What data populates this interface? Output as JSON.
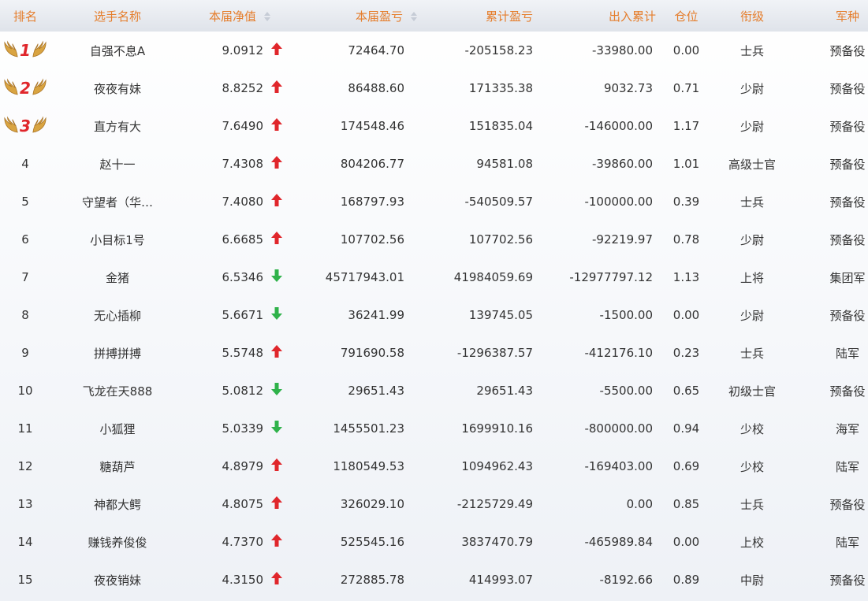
{
  "headers": {
    "rank": "排名",
    "name": "选手名称",
    "nav": "本届净值",
    "pnl": "本届盈亏",
    "cum": "累计盈亏",
    "flow": "出入累计",
    "position": "仓位",
    "military_rank": "衔级",
    "arm": "军种"
  },
  "colors": {
    "header_text": "#e57d2b",
    "up_arrow": "#e0262b",
    "down_arrow": "#2fb24a",
    "medal_number": "#e0262b"
  },
  "rows": [
    {
      "rank": "1",
      "name": "自强不息A",
      "nav": "9.0912",
      "dir": "up",
      "pnl": "72464.70",
      "cum": "-205158.23",
      "flow": "-33980.00",
      "position": "0.00",
      "military_rank": "士兵",
      "arm": "预备役"
    },
    {
      "rank": "2",
      "name": "夜夜有妹",
      "nav": "8.8252",
      "dir": "up",
      "pnl": "86488.60",
      "cum": "171335.38",
      "flow": "9032.73",
      "position": "0.71",
      "military_rank": "少尉",
      "arm": "预备役"
    },
    {
      "rank": "3",
      "name": "直方有大",
      "nav": "7.6490",
      "dir": "up",
      "pnl": "174548.46",
      "cum": "151835.04",
      "flow": "-146000.00",
      "position": "1.17",
      "military_rank": "少尉",
      "arm": "预备役"
    },
    {
      "rank": "4",
      "name": "赵十一",
      "nav": "7.4308",
      "dir": "up",
      "pnl": "804206.77",
      "cum": "94581.08",
      "flow": "-39860.00",
      "position": "1.01",
      "military_rank": "高级士官",
      "arm": "预备役"
    },
    {
      "rank": "5",
      "name": "守望者（华…",
      "nav": "7.4080",
      "dir": "up",
      "pnl": "168797.93",
      "cum": "-540509.57",
      "flow": "-100000.00",
      "position": "0.39",
      "military_rank": "士兵",
      "arm": "预备役"
    },
    {
      "rank": "6",
      "name": "小目标1号",
      "nav": "6.6685",
      "dir": "up",
      "pnl": "107702.56",
      "cum": "107702.56",
      "flow": "-92219.97",
      "position": "0.78",
      "military_rank": "少尉",
      "arm": "预备役"
    },
    {
      "rank": "7",
      "name": "金猪",
      "nav": "6.5346",
      "dir": "down",
      "pnl": "45717943.01",
      "cum": "41984059.69",
      "flow": "-12977797.12",
      "position": "1.13",
      "military_rank": "上将",
      "arm": "集团军"
    },
    {
      "rank": "8",
      "name": "无心插柳",
      "nav": "5.6671",
      "dir": "down",
      "pnl": "36241.99",
      "cum": "139745.05",
      "flow": "-1500.00",
      "position": "0.00",
      "military_rank": "少尉",
      "arm": "预备役"
    },
    {
      "rank": "9",
      "name": "拼搏拼搏",
      "nav": "5.5748",
      "dir": "up",
      "pnl": "791690.58",
      "cum": "-1296387.57",
      "flow": "-412176.10",
      "position": "0.23",
      "military_rank": "士兵",
      "arm": "陆军"
    },
    {
      "rank": "10",
      "name": "飞龙在天888",
      "nav": "5.0812",
      "dir": "down",
      "pnl": "29651.43",
      "cum": "29651.43",
      "flow": "-5500.00",
      "position": "0.65",
      "military_rank": "初级士官",
      "arm": "预备役"
    },
    {
      "rank": "11",
      "name": "小狐狸",
      "nav": "5.0339",
      "dir": "down",
      "pnl": "1455501.23",
      "cum": "1699910.16",
      "flow": "-800000.00",
      "position": "0.94",
      "military_rank": "少校",
      "arm": "海军"
    },
    {
      "rank": "12",
      "name": "糖葫芦",
      "nav": "4.8979",
      "dir": "up",
      "pnl": "1180549.53",
      "cum": "1094962.43",
      "flow": "-169403.00",
      "position": "0.69",
      "military_rank": "少校",
      "arm": "陆军"
    },
    {
      "rank": "13",
      "name": "神都大鳄",
      "nav": "4.8075",
      "dir": "up",
      "pnl": "326029.10",
      "cum": "-2125729.49",
      "flow": "0.00",
      "position": "0.85",
      "military_rank": "士兵",
      "arm": "预备役"
    },
    {
      "rank": "14",
      "name": "赚钱养俊俊",
      "nav": "4.7370",
      "dir": "up",
      "pnl": "525545.16",
      "cum": "3837470.79",
      "flow": "-465989.84",
      "position": "0.00",
      "military_rank": "上校",
      "arm": "陆军"
    },
    {
      "rank": "15",
      "name": "夜夜销妹",
      "nav": "4.3150",
      "dir": "up",
      "pnl": "272885.78",
      "cum": "414993.07",
      "flow": "-8192.66",
      "position": "0.89",
      "military_rank": "中尉",
      "arm": "预备役"
    }
  ]
}
